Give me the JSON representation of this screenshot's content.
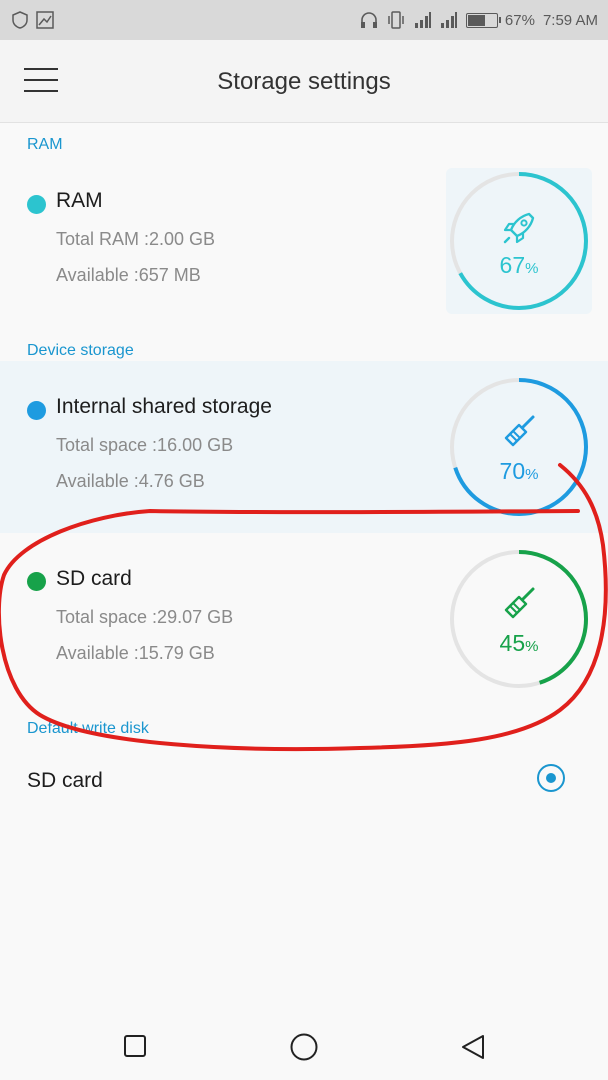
{
  "status_bar": {
    "battery": "67%",
    "time": "7:59 AM",
    "battery_level": 0.67
  },
  "app_bar": {
    "title": "Storage settings"
  },
  "sections": {
    "ram_label": "RAM",
    "device_label": "Device storage",
    "default_label": "Default write disk"
  },
  "ram": {
    "title": "RAM",
    "total": "Total RAM :2.00 GB",
    "available": "Available :657 MB",
    "percent": "67",
    "percent_sign": "%",
    "usage": 0.67,
    "color": "#2cc4cf"
  },
  "internal": {
    "title": "Internal shared storage",
    "total": "Total space :16.00 GB",
    "available": "Available :4.76 GB",
    "percent": "70",
    "percent_sign": "%",
    "usage": 0.7,
    "color": "#1e9be0"
  },
  "sdcard": {
    "title": "SD card",
    "total": "Total space :29.07 GB",
    "available": "Available :15.79 GB",
    "percent": "45",
    "percent_sign": "%",
    "usage": 0.45,
    "color": "#17a24a"
  },
  "default_write": {
    "label": "SD card"
  },
  "annotation_color": "#e0201c"
}
